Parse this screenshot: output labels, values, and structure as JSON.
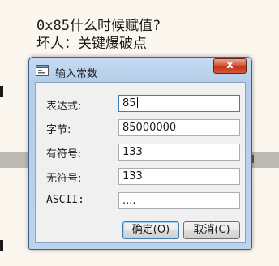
{
  "background": {
    "line1": "0x85什么时候赋值?",
    "line2": "坏人：关键爆破点"
  },
  "dialog": {
    "title": "输入常数",
    "close_label": "x",
    "fields": [
      {
        "label": "表达式:",
        "value": "85"
      },
      {
        "label": "字节:",
        "value": "85000000"
      },
      {
        "label": "有符号:",
        "value": "133"
      },
      {
        "label": "无符号:",
        "value": "133"
      },
      {
        "label": "ASCII:",
        "value": "...."
      }
    ],
    "ok_label": "确定(O)",
    "cancel_label": "取消(C)"
  },
  "colors": {
    "title_bar": "#c7dcf4",
    "close_button": "#c2361b",
    "client_bg": "#f0f0f0"
  }
}
